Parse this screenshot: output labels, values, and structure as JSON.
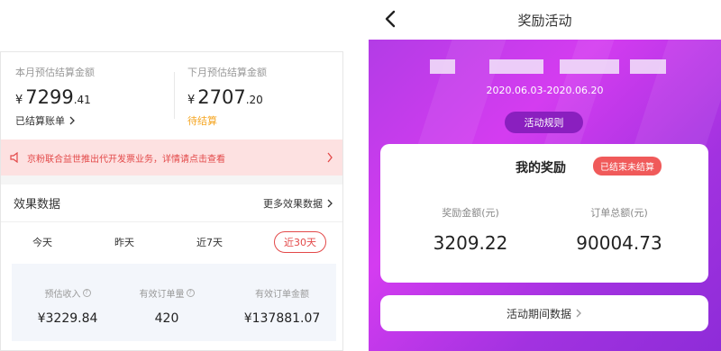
{
  "left": {
    "current_month_label": "本月预估结算金额",
    "current_month_currency": "¥",
    "current_month_int": "7299",
    "current_month_dec": ".41",
    "settled_bill_link": "已结算账单",
    "next_month_label": "下月预估结算金额",
    "next_month_currency": "¥",
    "next_month_int": "2707",
    "next_month_dec": ".20",
    "pending_label": "待结算",
    "notice_text": "京粉联合益世推出代开发票业务，详情请点击查看",
    "effect_title": "效果数据",
    "more_effect_link": "更多效果数据",
    "tabs": [
      "今天",
      "昨天",
      "近7天",
      "近30天"
    ],
    "active_tab": "近30天",
    "stats": [
      {
        "label": "预估收入",
        "value": "¥3229.84",
        "help": true
      },
      {
        "label": "有效订单量",
        "value": "420",
        "help": true
      },
      {
        "label": "有效订单金额",
        "value": "¥137881.07",
        "help": false
      }
    ]
  },
  "right": {
    "title": "奖励活动",
    "date_range": "2020.06.03-2020.06.20",
    "rules_button": "活动规则",
    "reward_title": "我的奖励",
    "status_badge": "已结束未结算",
    "reward_amount_label": "奖励金额(元)",
    "reward_amount_value": "3209.22",
    "order_total_label": "订单总额(元)",
    "order_total_value": "90004.73",
    "period_data_link": "活动期间数据",
    "colors": {
      "hero_purple": "#c23ae8",
      "badge_red": "#f05a5a",
      "rules_button": "#8a1fbf"
    }
  },
  "icons": {
    "back": "back-arrow-icon",
    "speaker": "speaker-icon",
    "chevron": "chevron-right-icon",
    "help": "question-circle-icon"
  },
  "colors": {
    "accent_red": "#e34949",
    "pending_orange": "#f5a623",
    "notice_bg": "#fde1e1"
  }
}
